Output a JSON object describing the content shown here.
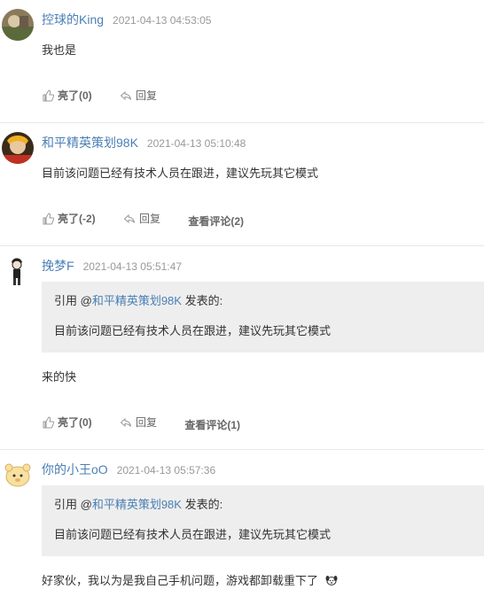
{
  "comments": [
    {
      "user": "控球的King",
      "time": "2021-04-13 04:53:05",
      "text": "我也是",
      "like_label": "亮了(0)",
      "reply_label": "回复"
    },
    {
      "user": "和平精英策划98K",
      "time": "2021-04-13 05:10:48",
      "text": "目前该问题已经有技术人员在跟进，建议先玩其它模式",
      "like_label": "亮了(-2)",
      "reply_label": "回复",
      "view_label": "查看评论(2)"
    },
    {
      "user": "挽梦F",
      "time": "2021-04-13 05:51:47",
      "quote": {
        "prefix": "引用 @",
        "ref_user": "和平精英策划98K",
        "suffix": " 发表的:",
        "text": "目前该问题已经有技术人员在跟进，建议先玩其它模式"
      },
      "text": "来的快",
      "like_label": "亮了(0)",
      "reply_label": "回复",
      "view_label": "查看评论(1)"
    },
    {
      "user": "你的小王oO",
      "time": "2021-04-13 05:57:36",
      "quote": {
        "prefix": "引用 @",
        "ref_user": "和平精英策划98K",
        "suffix": " 发表的:",
        "text": "目前该问题已经有技术人员在跟进，建议先玩其它模式"
      },
      "text": "好家伙，我以为是我自己手机问题，游戏都卸载重下了"
    }
  ],
  "colors": {
    "username": "#4a7fb5",
    "quote_bg": "#eeeeee",
    "divider": "#e8e8e8"
  }
}
